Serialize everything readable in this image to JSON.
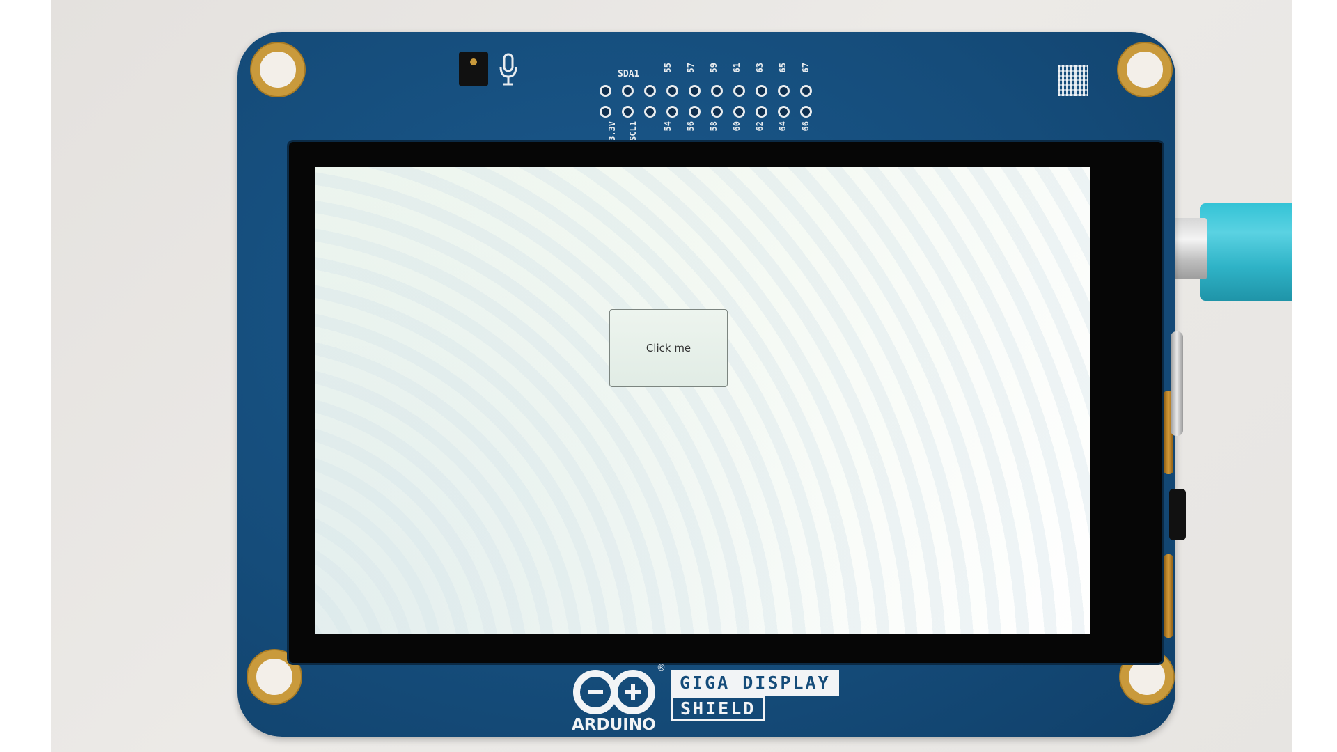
{
  "display": {
    "button_label": "Click me"
  },
  "board": {
    "brand": "ARDUINO",
    "registered_mark": "®",
    "product_line1": "GIGA DISPLAY",
    "product_line2": "SHIELD",
    "silkscreen": {
      "sda": "SDA1",
      "scl": "SCL1",
      "voltage": "3.3V",
      "pins_top": [
        "55",
        "57",
        "59",
        "61",
        "63",
        "65",
        "67"
      ],
      "pins_bottom": [
        "54",
        "56",
        "58",
        "60",
        "62",
        "64",
        "66"
      ]
    }
  },
  "colors": {
    "pcb": "#154c7a",
    "screen": "#f2f8f1",
    "cable": "#34c3d6",
    "gold": "#c99a3c"
  },
  "icons": [
    "microphone-icon",
    "arduino-infinity-logo-icon",
    "qr-code-icon"
  ]
}
